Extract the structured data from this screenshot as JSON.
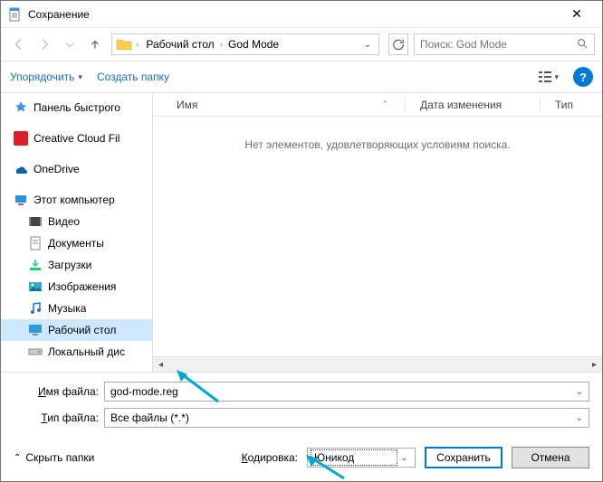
{
  "titlebar": {
    "title": "Сохранение"
  },
  "nav": {
    "crumbs": [
      "Рабочий стол",
      "God Mode"
    ],
    "search_placeholder": "Поиск: God Mode"
  },
  "toolbar": {
    "organize": "Упорядочить",
    "newfolder": "Создать папку",
    "help_glyph": "?"
  },
  "columns": {
    "name": "Имя",
    "date": "Дата изменения",
    "type": "Тип"
  },
  "empty_text": "Нет элементов, удовлетворяющих условиям поиска.",
  "tree": {
    "quick": "Панель быстрого",
    "cc": "Creative Cloud Fil",
    "onedrive": "OneDrive",
    "thispc": "Этот компьютер",
    "videos": "Видео",
    "documents": "Документы",
    "downloads": "Загрузки",
    "pictures": "Изображения",
    "music": "Музыка",
    "desktop": "Рабочий стол",
    "localdisk": "Локальный дис"
  },
  "form": {
    "filename_label": "Имя файла:",
    "filename_value": "god-mode.reg",
    "filetype_label": "Тип файла:",
    "filetype_value": "Все файлы  (*.*)"
  },
  "footer": {
    "hide_folders": "Скрыть папки",
    "encoding_label": "Кодировка:",
    "encoding_value": "Юникод",
    "save": "Сохранить",
    "cancel": "Отмена"
  }
}
